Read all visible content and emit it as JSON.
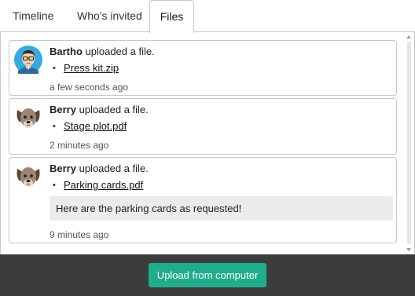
{
  "tabs": [
    {
      "label": "Timeline",
      "active": false
    },
    {
      "label": "Who's invited",
      "active": false
    },
    {
      "label": "Files",
      "active": true
    }
  ],
  "feed": {
    "entries": [
      {
        "user": "Bartho",
        "action": "uploaded a file.",
        "avatar": "man-avatar-icon",
        "files": [
          "Press kit.zip"
        ],
        "message": "",
        "time": "a few seconds ago"
      },
      {
        "user": "Berry",
        "action": "uploaded a file.",
        "avatar": "dog-avatar-icon",
        "files": [
          "Stage plot.pdf"
        ],
        "message": "",
        "time": "2 minutes ago"
      },
      {
        "user": "Berry",
        "action": "uploaded a file.",
        "avatar": "dog-avatar-icon",
        "files": [
          "Parking cards.pdf"
        ],
        "message": "Here are the parking cards as requested!",
        "time": "9 minutes ago"
      }
    ]
  },
  "footer": {
    "upload_label": "Upload from computer"
  },
  "colors": {
    "accent": "#1fae8b",
    "footer_bg": "#3c3c3c",
    "message_bg": "#e9ebec",
    "border": "#c8c8c8"
  }
}
